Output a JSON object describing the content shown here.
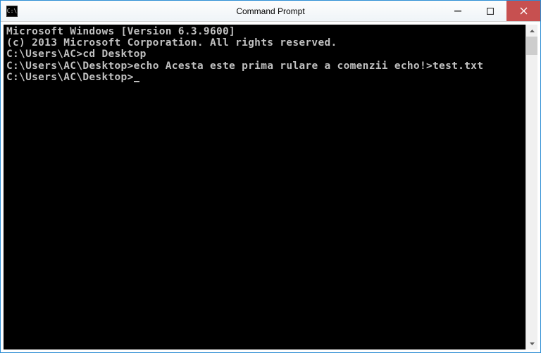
{
  "window": {
    "title": "Command Prompt"
  },
  "console": {
    "line1": "Microsoft Windows [Version 6.3.9600]",
    "line2": "(c) 2013 Microsoft Corporation. All rights reserved.",
    "blank1": "",
    "prompt1": "C:\\Users\\AC>",
    "cmd1": "cd Desktop",
    "blank2": "",
    "prompt2": "C:\\Users\\AC\\Desktop>",
    "cmd2": "echo Acesta este prima rulare a comenzii echo!>test.txt",
    "blank3": "",
    "prompt3": "C:\\Users\\AC\\Desktop>"
  }
}
